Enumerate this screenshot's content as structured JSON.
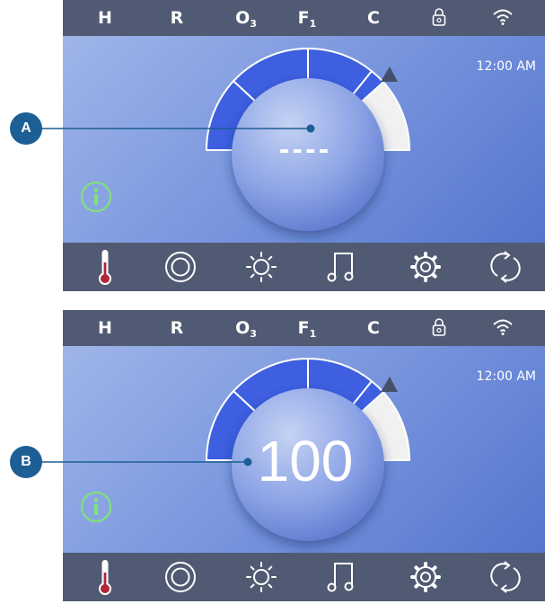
{
  "screens": [
    {
      "id": "A",
      "status_indicators": [
        {
          "main": "H",
          "sub": ""
        },
        {
          "main": "R",
          "sub": ""
        },
        {
          "main": "O",
          "sub": "3"
        },
        {
          "main": "F",
          "sub": "1"
        },
        {
          "main": "C",
          "sub": ""
        }
      ],
      "clock": "12:00 AM",
      "center_display": "----",
      "nav_icons": [
        "thermometer-icon",
        "jets-icon",
        "light-icon",
        "music-icon",
        "settings-icon",
        "refresh-icon"
      ]
    },
    {
      "id": "B",
      "status_indicators": [
        {
          "main": "H",
          "sub": ""
        },
        {
          "main": "R",
          "sub": ""
        },
        {
          "main": "O",
          "sub": "3"
        },
        {
          "main": "F",
          "sub": "1"
        },
        {
          "main": "C",
          "sub": ""
        }
      ],
      "clock": "12:00 AM",
      "center_display": "100",
      "nav_icons": [
        "thermometer-icon",
        "jets-icon",
        "light-icon",
        "music-icon",
        "settings-icon",
        "refresh-icon"
      ]
    }
  ],
  "callouts": {
    "a_label": "A",
    "b_label": "B"
  },
  "colors": {
    "status_bar": "#505a72",
    "dial_fill": "#3d5fe0",
    "callout": "#1d5f94",
    "info_green": "#7fe27a",
    "thermometer_red": "#b2243b"
  }
}
